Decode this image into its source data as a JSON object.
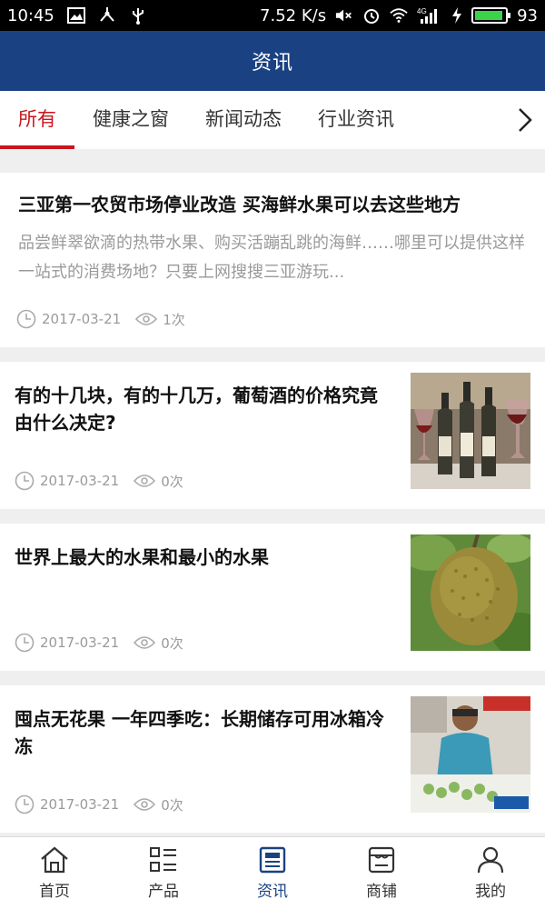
{
  "status_bar": {
    "time": "10:45",
    "speed": "7.52 K/s",
    "network": "4G",
    "battery": "93",
    "battery_level": 0.93,
    "battery_color": "#3cd24a",
    "icons": [
      "image-icon",
      "usb-share-icon",
      "usb-icon",
      "mute-icon",
      "alarm-icon",
      "wifi-icon",
      "signal-icon",
      "charging-icon"
    ]
  },
  "header": {
    "title": "资讯",
    "bg_color": "#1a4282"
  },
  "tabs": {
    "items": [
      {
        "label": "所有",
        "active": true
      },
      {
        "label": "健康之窗",
        "active": false
      },
      {
        "label": "新闻动态",
        "active": false
      },
      {
        "label": "行业资讯",
        "active": false
      }
    ],
    "accent_color": "#c9161d",
    "more_icon": "chevron-right-icon"
  },
  "news": [
    {
      "title": "三亚第一农贸市场停业改造 买海鲜水果可以去这些地方",
      "summary": "品尝鲜翠欲滴的热带水果、购买活蹦乱跳的海鲜……哪里可以提供这样一站式的消费场地？只要上网搜搜三亚游玩...",
      "date": "2017-03-21",
      "views": "1次"
    },
    {
      "title": "有的十几块，有的十几万，葡萄酒的价格究竟由什么决定?",
      "date": "2017-03-21",
      "views": "0次",
      "thumb": "wine-bottles-photo"
    },
    {
      "title": "世界上最大的水果和最小的水果",
      "date": "2017-03-21",
      "views": "0次",
      "thumb": "jackfruit-photo"
    },
    {
      "title": "囤点无花果 一年四季吃：长期储存可用冰箱冷冻",
      "date": "2017-03-21",
      "views": "0次",
      "thumb": "figs-vendor-photo"
    }
  ],
  "bottom_nav": {
    "items": [
      {
        "label": "首页",
        "icon": "home-icon",
        "active": false
      },
      {
        "label": "产品",
        "icon": "grid-list-icon",
        "active": false
      },
      {
        "label": "资讯",
        "icon": "news-icon",
        "active": true
      },
      {
        "label": "商铺",
        "icon": "store-icon",
        "active": false
      },
      {
        "label": "我的",
        "icon": "user-icon",
        "active": false
      }
    ]
  }
}
